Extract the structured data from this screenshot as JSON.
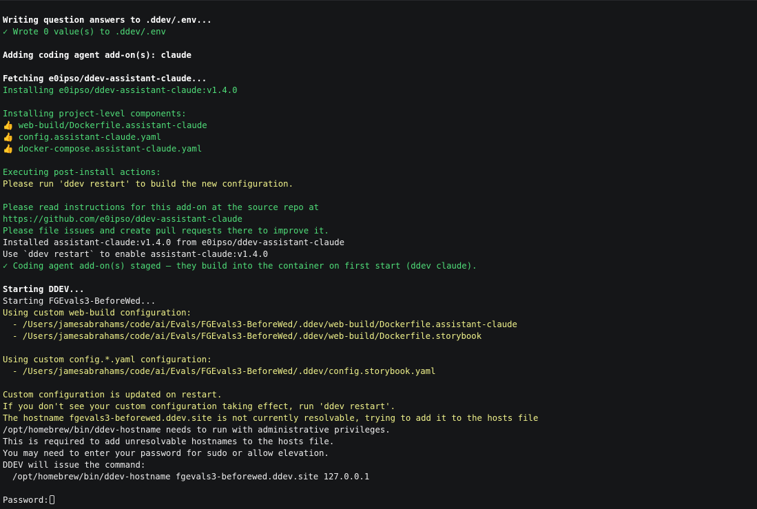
{
  "terminal": {
    "lines": [
      "Writing question answers to .ddev/.env...",
      "✓ Wrote 0 value(s) to .ddev/.env",
      "",
      "Adding coding agent add-on(s): claude",
      "",
      "Fetching e0ipso/ddev-assistant-claude...",
      "Installing e0ipso/ddev-assistant-claude:v1.4.0",
      "",
      "Installing project-level components:",
      "web-build/Dockerfile.assistant-claude",
      "config.assistant-claude.yaml",
      "docker-compose.assistant-claude.yaml",
      "",
      "Executing post-install actions:",
      "Please run 'ddev restart' to build the new configuration.",
      "",
      "Please read instructions for this add-on at the source repo at",
      "https://github.com/e0ipso/ddev-assistant-claude",
      "Please file issues and create pull requests there to improve it.",
      "Installed assistant-claude:v1.4.0 from e0ipso/ddev-assistant-claude",
      "Use `ddev restart` to enable assistant-claude:v1.4.0",
      "✓ Coding agent add-on(s) staged — they build into the container on first start (ddev claude).",
      "",
      "Starting DDEV...",
      "Starting FGEvals3-BeforeWed...",
      "Using custom web-build configuration:",
      "- /Users/jamesabrahams/code/ai/Evals/FGEvals3-BeforeWed/.ddev/web-build/Dockerfile.assistant-claude",
      "- /Users/jamesabrahams/code/ai/Evals/FGEvals3-BeforeWed/.ddev/web-build/Dockerfile.storybook",
      "",
      "Using custom config.*.yaml configuration:",
      "- /Users/jamesabrahams/code/ai/Evals/FGEvals3-BeforeWed/.ddev/config.storybook.yaml",
      "",
      "Custom configuration is updated on restart.",
      "If you don't see your custom configuration taking effect, run 'ddev restart'.",
      "The hostname fgevals3-beforewed.ddev.site is not currently resolvable, trying to add it to the hosts file",
      "/opt/homebrew/bin/ddev-hostname needs to run with administrative privileges.",
      "This is required to add unresolvable hostnames to the hosts file.",
      "You may need to enter your password for sudo or allow elevation.",
      "DDEV will issue the command:",
      "/opt/homebrew/bin/ddev-hostname fgevals3-beforewed.ddev.site 127.0.0.1",
      "",
      "Password:"
    ],
    "thumbs_up_icon": "thumbs-up-icon",
    "colors": {
      "background": "#151618",
      "default": "#ececec",
      "green": "#4fdc78",
      "yellow": "#eef08a"
    }
  }
}
